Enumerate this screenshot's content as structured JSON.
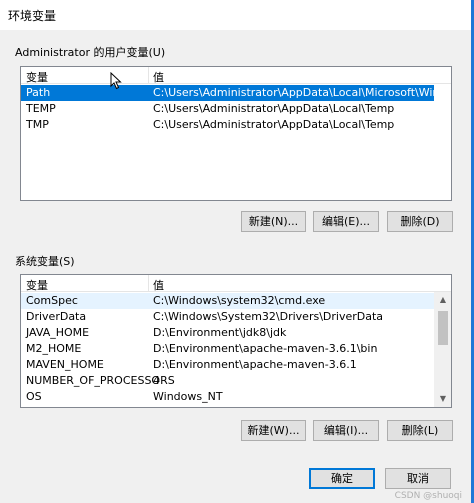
{
  "window": {
    "title": "环境变量"
  },
  "user_vars": {
    "group_label": "Administrator 的用户变量(U)",
    "col_variable": "变量",
    "col_value": "值",
    "rows": [
      {
        "name": "Path",
        "value": "C:\\Users\\Administrator\\AppData\\Local\\Microsoft\\WindowsA..."
      },
      {
        "name": "TEMP",
        "value": "C:\\Users\\Administrator\\AppData\\Local\\Temp"
      },
      {
        "name": "TMP",
        "value": "C:\\Users\\Administrator\\AppData\\Local\\Temp"
      }
    ],
    "buttons": {
      "new": "新建(N)...",
      "edit": "编辑(E)...",
      "delete": "删除(D)"
    }
  },
  "system_vars": {
    "group_label": "系统变量(S)",
    "col_variable": "变量",
    "col_value": "值",
    "rows": [
      {
        "name": "ComSpec",
        "value": "C:\\Windows\\system32\\cmd.exe"
      },
      {
        "name": "DriverData",
        "value": "C:\\Windows\\System32\\Drivers\\DriverData"
      },
      {
        "name": "JAVA_HOME",
        "value": "D:\\Environment\\jdk8\\jdk"
      },
      {
        "name": "M2_HOME",
        "value": "D:\\Environment\\apache-maven-3.6.1\\bin"
      },
      {
        "name": "MAVEN_HOME",
        "value": "D:\\Environment\\apache-maven-3.6.1"
      },
      {
        "name": "NUMBER_OF_PROCESSORS",
        "value": "4"
      },
      {
        "name": "OS",
        "value": "Windows_NT"
      }
    ],
    "buttons": {
      "new": "新建(W)...",
      "edit": "编辑(I)...",
      "delete": "删除(L)"
    }
  },
  "footer": {
    "ok": "确定",
    "cancel": "取消"
  },
  "watermark": "CSDN @shuoqi",
  "colors": {
    "selection": "#0078d7",
    "hover": "#e5f3ff",
    "dialog_bg": "#f0f0f0"
  }
}
